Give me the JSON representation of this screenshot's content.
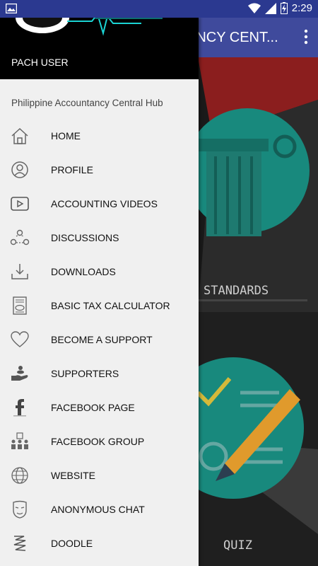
{
  "status_bar": {
    "time": "2:29",
    "battery_indicator": "charging"
  },
  "toolbar": {
    "title": "ANCY CENT..."
  },
  "background_cards": {
    "card1_label": "STANDARDS",
    "card2_label": "QUIZ"
  },
  "drawer": {
    "user_name": "PACH USER",
    "subtitle": "Philippine Accountancy Central Hub",
    "items": [
      {
        "label": "HOME",
        "icon": "home-icon"
      },
      {
        "label": "PROFILE",
        "icon": "profile-icon"
      },
      {
        "label": "ACCOUNTING VIDEOS",
        "icon": "video-icon"
      },
      {
        "label": "DISCUSSIONS",
        "icon": "discussion-icon"
      },
      {
        "label": "DOWNLOADS",
        "icon": "download-icon"
      },
      {
        "label": "BASIC TAX CALCULATOR",
        "icon": "tax-calculator-icon"
      },
      {
        "label": "BECOME A SUPPORT",
        "icon": "heart-icon"
      },
      {
        "label": "SUPPORTERS",
        "icon": "supporters-icon"
      },
      {
        "label": "FACEBOOK PAGE",
        "icon": "facebook-icon"
      },
      {
        "label": "FACEBOOK GROUP",
        "icon": "group-icon"
      },
      {
        "label": "WEBSITE",
        "icon": "globe-icon"
      },
      {
        "label": "ANONYMOUS CHAT",
        "icon": "mask-icon"
      },
      {
        "label": "DOODLE",
        "icon": "doodle-icon"
      }
    ]
  }
}
